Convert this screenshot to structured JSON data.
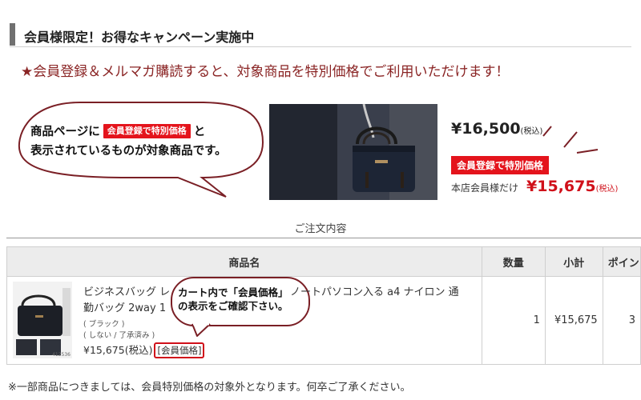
{
  "section": {
    "title": "会員様限定！お得なキャンペーン実施中"
  },
  "promo": {
    "text": "★会員登録＆メルマガ購読すると、対象商品を特別価格でご利用いただけます！"
  },
  "bubble1": {
    "line1_before": "商品ページに",
    "badge": "会員登録で特別価格",
    "line1_after": "と",
    "line2": "表示されているものが対象商品です。"
  },
  "product_display": {
    "price": "¥16,500",
    "price_tax": "(税込)",
    "badge": "会員登録で特別価格",
    "member_label": "本店会員様だけ",
    "member_price": "¥15,675",
    "member_tax": "(税込)"
  },
  "order": {
    "title": "ご注文内容",
    "headers": [
      "商品名",
      "数量",
      "小計",
      "ポイン"
    ],
    "item": {
      "name": "ビジネスバッグ レ                    ノートパソコン入る a4 ナイロン 通勤バッグ 2way 1",
      "name_line1": "ビジネスバッグ レ",
      "name_line1b": "ノートパソコン入る a4 ナイロン 通",
      "name_line2": "勤バッグ 2way 1",
      "color": "( ブラック )",
      "option": "( しない / 了承済み )",
      "price": "¥15,675",
      "price_tax": "(税込)",
      "member_tag": "[会員価格]",
      "quantity": "1",
      "subtotal": "¥15,675",
      "points": "3",
      "thumb_code": "412536"
    }
  },
  "bubble2": {
    "line1": "カート内で「会員価格」",
    "line2": "の表示をご確認下さい。"
  },
  "footnote": "※一部商品につきましては、会員特別価格の対象外となります。何卒ご了承ください。",
  "colors": {
    "accent_red": "#e4141c",
    "bubble_border": "#7a1f25",
    "promo_text": "#8a2424"
  }
}
